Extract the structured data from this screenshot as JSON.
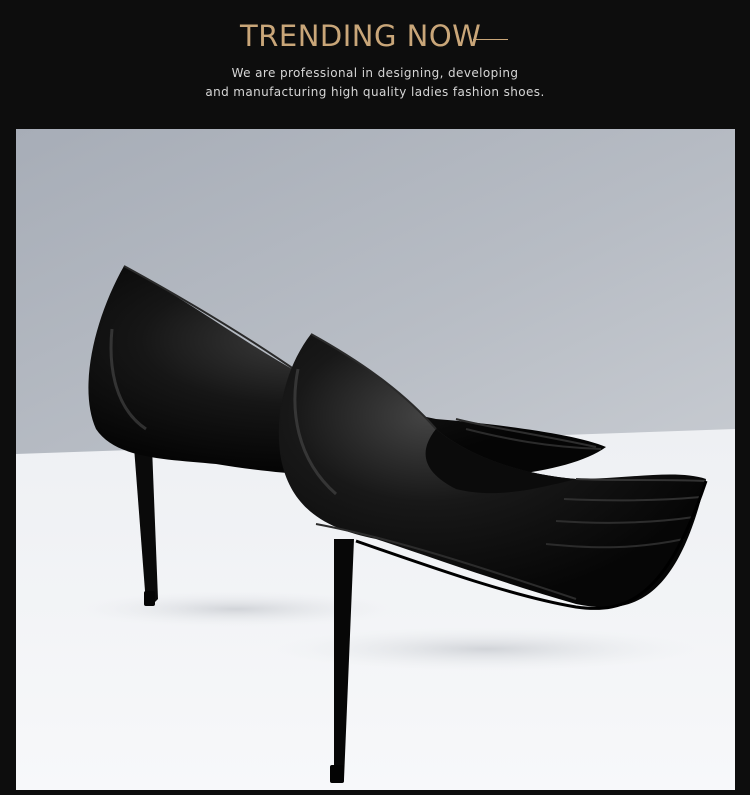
{
  "header": {
    "title": "TRENDING NOW",
    "subtitle_line1": "We are professional in designing, developing",
    "subtitle_line2": "and manufacturing high quality ladies fashion shoes."
  },
  "photo": {
    "subject": "pair of black pointed-toe stiletto pumps",
    "colors": {
      "wall": "#aeb4bd",
      "floor": "#f2f3f5",
      "shoe": "#111111",
      "accent_gold": "#c9a679",
      "header_bg": "#0d0d0d"
    }
  }
}
